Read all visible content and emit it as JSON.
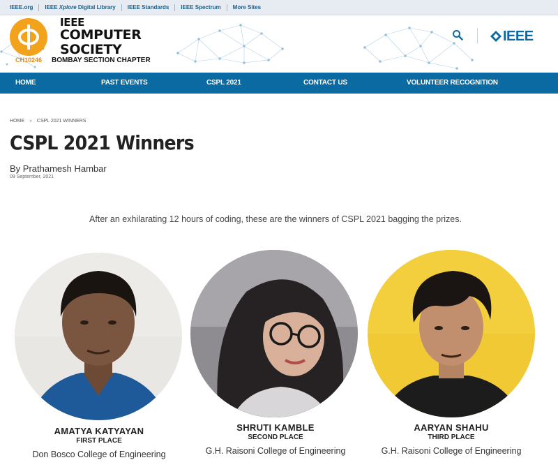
{
  "topbar": {
    "links": [
      {
        "label": "IEEE.org"
      },
      {
        "label_a": "IEEE ",
        "label_em": "Xplore",
        "label_b": " Digital Library"
      },
      {
        "label": "IEEE Standards"
      },
      {
        "label": "IEEE Spectrum"
      },
      {
        "label": "More Sites"
      }
    ]
  },
  "header": {
    "logo_line1": "IEEE",
    "logo_line2": "COMPUTER",
    "logo_line3": "SOCIETY",
    "logo_code": "CH10246",
    "logo_subtitle": "BOMBAY SECTION CHAPTER",
    "brand_logo_text": "IEEE",
    "colors": {
      "accent_orange": "#f3a21b",
      "ieee_blue": "#0a6aa1",
      "nav_blue": "#0b6aa2"
    }
  },
  "nav": {
    "items": [
      {
        "label": "HOME"
      },
      {
        "label": "PAST EVENTS"
      },
      {
        "label": "CSPL 2021"
      },
      {
        "label": "CONTACT US"
      },
      {
        "label": "VOLUNTEER RECOGNITION"
      }
    ]
  },
  "breadcrumb": {
    "home": "HOME",
    "separator": "»",
    "current": "CSPL 2021 WINNERS"
  },
  "article": {
    "title": "CSPL 2021 Winners",
    "author": "By Prathamesh Hambar",
    "date": "09 September, 2021",
    "intro": "After an exhilarating 12 hours of coding, these are the winners of CSPL 2021 bagging the prizes."
  },
  "winners": [
    {
      "name": "AMATYA KATYAYAN",
      "place": "FIRST PLACE",
      "college": "Don Bosco College of Engineering"
    },
    {
      "name": "SHRUTI KAMBLE",
      "place": "SECOND PLACE",
      "college": "G.H. Raisoni College of Engineering"
    },
    {
      "name": "AARYAN SHAHU",
      "place": "THIRD PLACE",
      "college": "G.H. Raisoni College of Engineering"
    }
  ]
}
